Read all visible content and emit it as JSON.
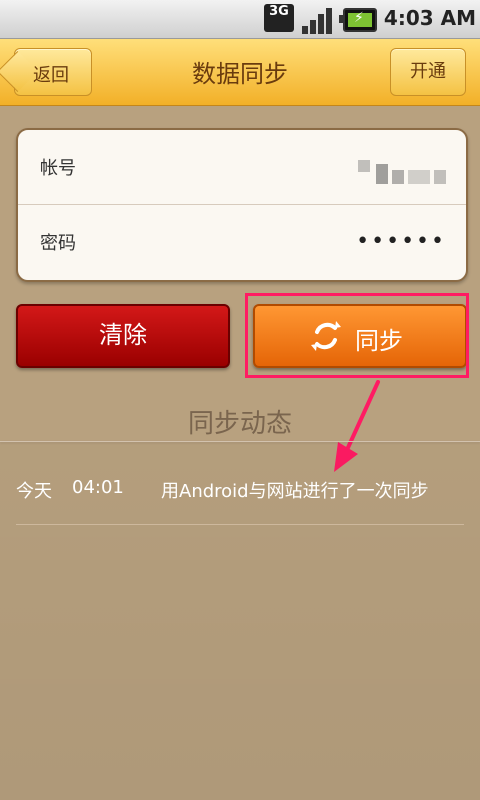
{
  "status_bar": {
    "network": "3G",
    "time": "4:03 AM",
    "icons": [
      "network-3g-icon",
      "signal-icon",
      "battery-icon"
    ]
  },
  "header": {
    "back_label": "返回",
    "title": "数据同步",
    "action_label": "开通"
  },
  "login": {
    "account_label": "帐号",
    "password_label": "密码",
    "password_value": "••••••"
  },
  "actions": {
    "clear_label": "清除",
    "sync_label": "同步",
    "sync_icon": "refresh-icon"
  },
  "activity": {
    "title": "同步动态",
    "items": [
      {
        "day": "今天",
        "time": "04:01",
        "text": "用Android与网站进行了一次同步"
      }
    ]
  },
  "annotation": {
    "highlight_color": "#ff1b63"
  }
}
